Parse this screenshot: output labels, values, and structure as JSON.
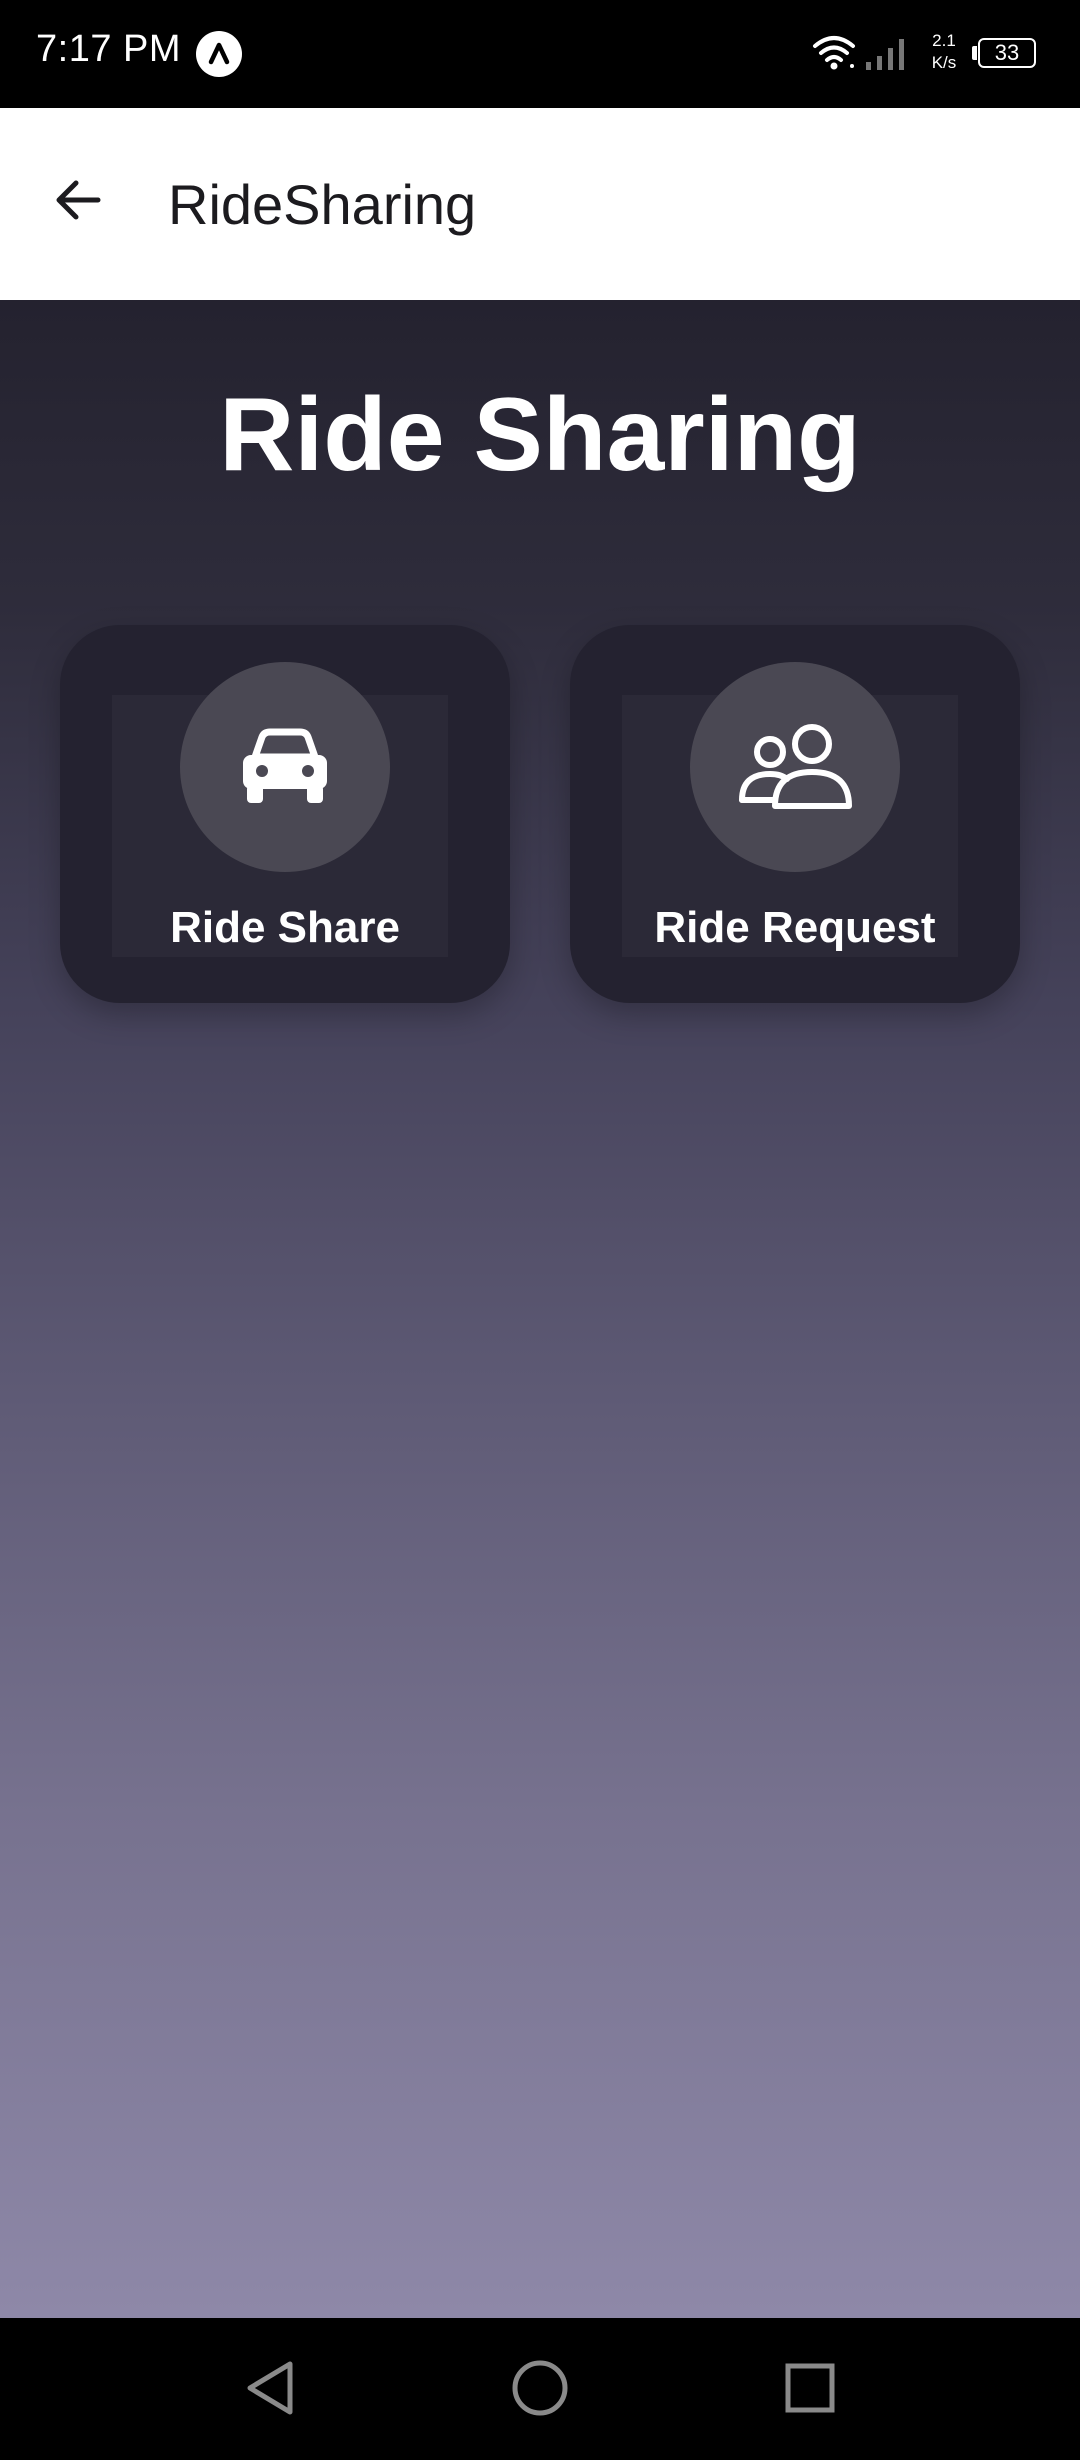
{
  "status_bar": {
    "time": "7:17 PM",
    "network_speed_value": "2.1",
    "network_speed_unit": "K/s",
    "battery_level": "33"
  },
  "app_bar": {
    "title": "RideSharing",
    "back_icon": "arrow-left-icon"
  },
  "main": {
    "heading": "Ride Sharing",
    "cards": [
      {
        "label": "Ride Share",
        "icon": "car-icon"
      },
      {
        "label": "Ride Request",
        "icon": "people-icon"
      }
    ]
  },
  "nav_bar": {
    "icons": [
      "back-triangle-icon",
      "home-circle-icon",
      "recents-square-icon"
    ]
  },
  "colors": {
    "app_bar_bg": "#ffffff",
    "card_bg": "#242230",
    "icon_circle_bg": "#4a4853",
    "gradient_top": "#24222f",
    "gradient_bottom": "#8e88a8"
  }
}
